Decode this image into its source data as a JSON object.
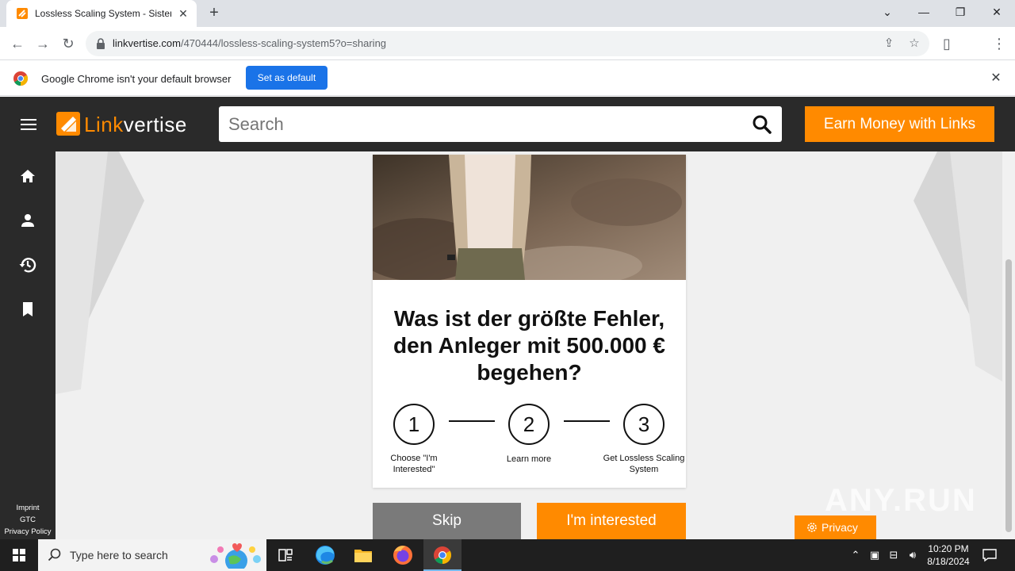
{
  "browser": {
    "tab_title": "Lossless Scaling System - Sistem",
    "new_tab": "+",
    "url_domain": "linkvertise.com",
    "url_path": "/470444/lossless-scaling-system5?o=sharing"
  },
  "infobar": {
    "message": "Google Chrome isn't your default browser",
    "button": "Set as default"
  },
  "site": {
    "brand_orange": "Link",
    "brand_white": "vertise",
    "search_placeholder": "Search",
    "earn_button": "Earn Money with Links",
    "accent": "#ff8a00"
  },
  "sidenav": {
    "footer": [
      "Imprint",
      "GTC",
      "Privacy Policy"
    ]
  },
  "card": {
    "headline": "Was ist der größte Fehler, den Anleger mit 500.000 € begehen?",
    "steps": [
      {
        "num": "1",
        "label": "Choose \"I'm Interested\""
      },
      {
        "num": "2",
        "label": "Learn more"
      },
      {
        "num": "3",
        "label": "Get Lossless Scaling System"
      }
    ]
  },
  "actions": {
    "skip": "Skip",
    "interested": "I'm interested",
    "privacy": "Privacy"
  },
  "watermark": "ANY.RUN",
  "taskbar": {
    "search_placeholder": "Type here to search",
    "time": "10:20 PM",
    "date": "8/18/2024"
  }
}
